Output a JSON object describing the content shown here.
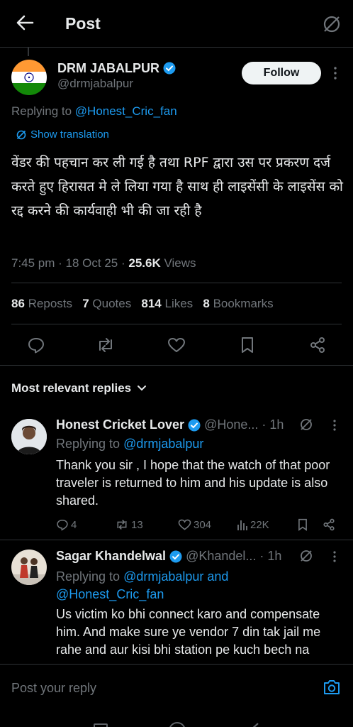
{
  "header": {
    "title": "Post"
  },
  "post": {
    "author_name": "DRM JABALPUR",
    "author_handle": "@drmjabalpur",
    "follow_label": "Follow",
    "replying_prefix": "Replying to ",
    "replying_to": "@Honest_Cric_fan",
    "show_translation": "Show translation",
    "text": "वेंडर की पहचान कर ली गई है तथा RPF द्वारा उस पर प्रकरण दर्ज करते हुए हिरासत मे ले लिया गया है साथ ही लाइसेंसी के लाइसेंस को रद्द करने की कार्यवाही भी की जा रही है",
    "time": "7:45 pm",
    "date": "18 Oct 25",
    "views_count": "25.6K",
    "views_label": "Views",
    "reposts_count": "86",
    "reposts_label": "Reposts",
    "quotes_count": "7",
    "quotes_label": "Quotes",
    "likes_count": "814",
    "likes_label": "Likes",
    "bookmarks_count": "8",
    "bookmarks_label": "Bookmarks"
  },
  "replies_header": "Most relevant replies",
  "replies": [
    {
      "name": "Honest Cricket Lover",
      "handle": "@Hone...",
      "time": "1h",
      "replying_prefix": "Replying to ",
      "replying_to": "@drmjabalpur",
      "text": "Thank you sir , I hope that the watch of that poor traveler is returned to him and his update is also shared.",
      "replies_count": "4",
      "reposts_count": "13",
      "likes_count": "304",
      "views_count": "22K"
    },
    {
      "name": "Sagar Khandelwal",
      "handle": "@Khandel...",
      "time": "1h",
      "replying_prefix": "Replying to ",
      "replying_to": "@drmjabalpur and @Honest_Cric_fan",
      "text": "Us victim ko bhi connect karo and compensate him. And make sure ye vendor 7 din tak jail me rahe and aur kisi bhi station pe kuch bech na"
    }
  ],
  "compose": {
    "placeholder": "Post your reply"
  },
  "colors": {
    "accent": "#1d9bf0",
    "background": "#000000",
    "muted": "#71767b"
  }
}
